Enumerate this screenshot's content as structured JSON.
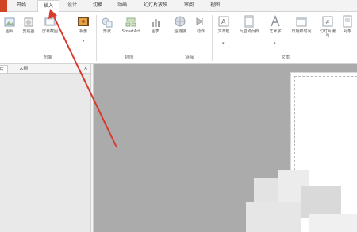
{
  "tabs": [
    {
      "label": "开始"
    },
    {
      "label": "插入"
    },
    {
      "label": "设计"
    },
    {
      "label": "切换"
    },
    {
      "label": "动画"
    },
    {
      "label": "幻灯片放映"
    },
    {
      "label": "审阅"
    },
    {
      "label": "视图"
    }
  ],
  "ribbon": {
    "images": {
      "buttons": [
        {
          "label": "图片"
        },
        {
          "label": "剪贴画"
        },
        {
          "label": "屏幕截图"
        },
        {
          "label": "相册"
        }
      ],
      "group_label": "图像"
    },
    "illustrations": {
      "buttons": [
        {
          "label": "形状"
        },
        {
          "label": "SmartArt"
        },
        {
          "label": "图表"
        }
      ],
      "group_label": "插图"
    },
    "links": {
      "buttons": [
        {
          "label": "超链接"
        },
        {
          "label": "动作"
        }
      ],
      "group_label": "链接"
    },
    "text": {
      "buttons": [
        {
          "label": "文本框"
        },
        {
          "label": "页眉和页脚"
        },
        {
          "label": "艺术字"
        },
        {
          "label": "日期和时间"
        },
        {
          "label": "幻灯片编号"
        },
        {
          "label": "对象"
        }
      ],
      "group_label": "文本"
    }
  },
  "left_pane": {
    "tabs": [
      {
        "label": "幻灯片"
      },
      {
        "label": "大纲"
      }
    ],
    "close_glyph": "×"
  },
  "annotation": {
    "color": "#d9392e"
  },
  "colors": {
    "file_tab": "#d04423",
    "workspace": "#ababab"
  }
}
